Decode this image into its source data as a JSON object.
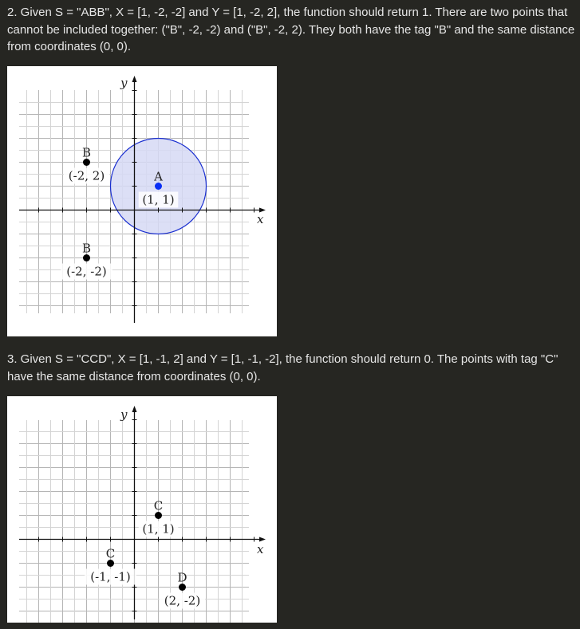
{
  "paragraphs": [
    "2. Given S = \"ABB\", X = [1, -2, -2] and Y = [1, -2, 2], the function should return 1. There are two points that cannot be included together: (\"B\", -2, -2) and (\"B\", -2, 2). They both have the tag \"B\" and the same distance from coordinates (0, 0).",
    "3. Given S = \"CCD\", X = [1, -1, 2] and Y = [1, -1, -2], the function should return 0. The points with tag \"C\" have the same distance from coordinates (0, 0)."
  ],
  "figures": [
    {
      "x_label": "x",
      "y_label": "y",
      "points": [
        {
          "tag": "B",
          "label": "(-2, 2)",
          "x": -2,
          "y": 2,
          "color": "#000000"
        },
        {
          "tag": "A",
          "label": "(1, 1)",
          "x": 1,
          "y": 1,
          "color": "#0a2ff5"
        },
        {
          "tag": "B",
          "label": "(-2, -2)",
          "x": -2,
          "y": -2,
          "color": "#000000"
        }
      ],
      "circle": {
        "center_x": 1,
        "center_y": 1,
        "radius": 2,
        "stroke": "#1a2fd0",
        "fill": "#d6d9f5"
      }
    },
    {
      "x_label": "x",
      "y_label": "y",
      "points": [
        {
          "tag": "C",
          "label": "(1, 1)",
          "x": 1,
          "y": 1,
          "color": "#000000"
        },
        {
          "tag": "C",
          "label": "(-1, -1)",
          "x": -1,
          "y": -1,
          "color": "#000000"
        },
        {
          "tag": "D",
          "label": "(2, -2)",
          "x": 2,
          "y": -2,
          "color": "#000000"
        }
      ]
    }
  ]
}
